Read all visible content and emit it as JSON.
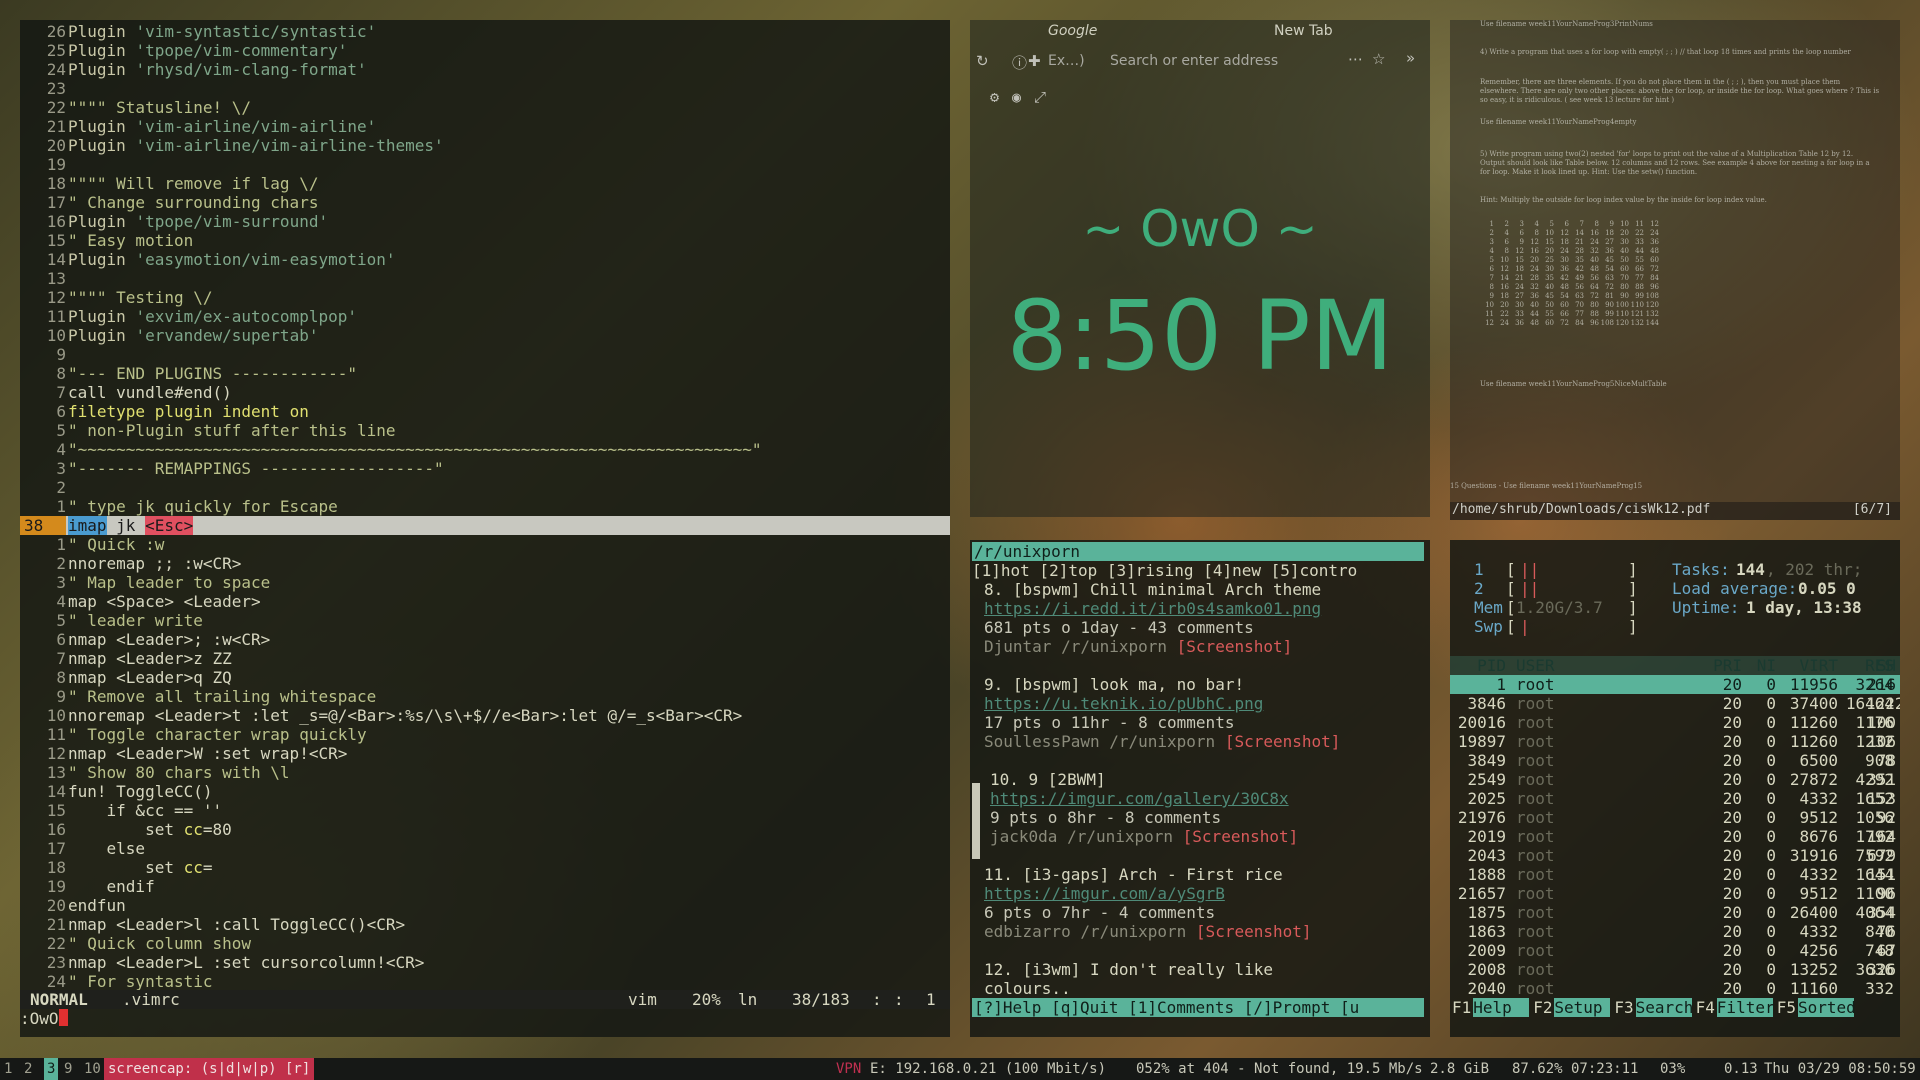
{
  "vim": {
    "lines": [
      {
        "num": "26",
        "segs": [
          [
            "Plugin ",
            "c-plug"
          ],
          [
            "'vim-syntastic/syntastic'",
            "c-str"
          ]
        ]
      },
      {
        "num": "25",
        "segs": [
          [
            "Plugin ",
            "c-plug"
          ],
          [
            "'tpope/vim-commentary'",
            "c-str"
          ]
        ]
      },
      {
        "num": "24",
        "segs": [
          [
            "Plugin ",
            "c-plug"
          ],
          [
            "'rhysd/vim-clang-format'",
            "c-str"
          ]
        ]
      },
      {
        "num": "23",
        "segs": []
      },
      {
        "num": "22",
        "segs": [
          [
            "\"\"\"\" Statusline! \\/",
            "c-com"
          ]
        ]
      },
      {
        "num": "21",
        "segs": [
          [
            "Plugin ",
            "c-plug"
          ],
          [
            "'vim-airline/vim-airline'",
            "c-str"
          ]
        ]
      },
      {
        "num": "20",
        "segs": [
          [
            "Plugin ",
            "c-plug"
          ],
          [
            "'vim-airline/vim-airline-themes'",
            "c-str"
          ]
        ]
      },
      {
        "num": "19",
        "segs": []
      },
      {
        "num": "18",
        "segs": [
          [
            "\"\"\"\" Will remove if lag \\/",
            "c-com"
          ]
        ]
      },
      {
        "num": "17",
        "segs": [
          [
            "\" Change surrounding chars",
            "c-com"
          ]
        ]
      },
      {
        "num": "16",
        "segs": [
          [
            "Plugin ",
            "c-plug"
          ],
          [
            "'tpope/vim-surround'",
            "c-str"
          ]
        ]
      },
      {
        "num": "15",
        "segs": [
          [
            "\" Easy motion",
            "c-com"
          ]
        ]
      },
      {
        "num": "14",
        "segs": [
          [
            "Plugin ",
            "c-plug"
          ],
          [
            "'easymotion/vim-easymotion'",
            "c-str"
          ]
        ]
      },
      {
        "num": "13",
        "segs": []
      },
      {
        "num": "12",
        "segs": [
          [
            "\"\"\"\" Testing \\/",
            "c-com"
          ]
        ]
      },
      {
        "num": "11",
        "segs": [
          [
            "Plugin ",
            "c-plug"
          ],
          [
            "'exvim/ex-autocomplpop'",
            "c-str"
          ]
        ]
      },
      {
        "num": "10",
        "segs": [
          [
            "Plugin ",
            "c-plug"
          ],
          [
            "'ervandew/supertab'",
            "c-str"
          ]
        ]
      },
      {
        "num": "9",
        "segs": []
      },
      {
        "num": "8",
        "segs": [
          [
            "\"--- END PLUGINS ------------\"",
            "c-com"
          ]
        ]
      },
      {
        "num": "7",
        "segs": [
          [
            "call vundle#end()",
            ""
          ]
        ]
      },
      {
        "num": "6",
        "segs": [
          [
            "filetype ",
            "c-key"
          ],
          [
            "plugin indent on",
            "c-key"
          ]
        ]
      },
      {
        "num": "5",
        "segs": [
          [
            "\" non-Plugin stuff after this line",
            "c-com"
          ]
        ]
      },
      {
        "num": "4",
        "segs": [
          [
            "\"~~~~~~~~~~~~~~~~~~~~~~~~~~~~~~~~~~~~~~~~~~~~~~~~~~~~~~~~~~~~~~~~~~~~~~\"",
            "c-com"
          ]
        ]
      },
      {
        "num": "3",
        "segs": [
          [
            "\"------- REMAPPINGS ------------------\"",
            "c-com"
          ]
        ]
      },
      {
        "num": "2",
        "segs": []
      },
      {
        "num": "1",
        "segs": [
          [
            "\" type jk quickly for Escape",
            "c-com"
          ]
        ]
      },
      {
        "num": "38",
        "cur": true,
        "segs": [
          [
            "imap",
            "c-hl"
          ],
          [
            " jk ",
            ""
          ],
          [
            "<Esc>",
            "c-esc"
          ]
        ]
      },
      {
        "num": "1",
        "segs": [
          [
            "\" Quick :w",
            "c-com"
          ]
        ]
      },
      {
        "num": "2",
        "segs": [
          [
            "nnoremap ;; :w<CR>",
            ""
          ]
        ]
      },
      {
        "num": "3",
        "segs": [
          [
            "\" Map leader to space",
            "c-com"
          ]
        ]
      },
      {
        "num": "4",
        "segs": [
          [
            "map <Space> <Leader>",
            ""
          ]
        ]
      },
      {
        "num": "5",
        "segs": [
          [
            "\" leader write",
            "c-com"
          ]
        ]
      },
      {
        "num": "6",
        "segs": [
          [
            "nmap <Leader>; :w<CR>",
            ""
          ]
        ]
      },
      {
        "num": "7",
        "segs": [
          [
            "nmap <Leader>z ZZ",
            ""
          ]
        ]
      },
      {
        "num": "8",
        "segs": [
          [
            "nmap <Leader>q ZQ",
            ""
          ]
        ]
      },
      {
        "num": "9",
        "segs": [
          [
            "\" Remove all trailing whitespace",
            "c-com"
          ]
        ]
      },
      {
        "num": "10",
        "segs": [
          [
            "nnoremap <Leader>t :let _s=@/<Bar>:%s/\\s\\+$//e<Bar>:let @/=_s<Bar><CR>",
            ""
          ]
        ]
      },
      {
        "num": "11",
        "segs": [
          [
            "\" Toggle character wrap quickly",
            "c-com"
          ]
        ]
      },
      {
        "num": "12",
        "segs": [
          [
            "nmap <Leader>W :set wrap!<CR>",
            ""
          ]
        ]
      },
      {
        "num": "13",
        "segs": [
          [
            "\" Show 80 chars with \\l",
            "c-com"
          ]
        ]
      },
      {
        "num": "14",
        "segs": [
          [
            "fun! ToggleCC()",
            ""
          ]
        ]
      },
      {
        "num": "15",
        "segs": [
          [
            "    if &cc == ''",
            ""
          ]
        ]
      },
      {
        "num": "16",
        "segs": [
          [
            "        set ",
            ""
          ],
          [
            "cc",
            "c-key"
          ],
          [
            "=80",
            ""
          ]
        ]
      },
      {
        "num": "17",
        "segs": [
          [
            "    else",
            ""
          ]
        ]
      },
      {
        "num": "18",
        "segs": [
          [
            "        set ",
            ""
          ],
          [
            "cc",
            "c-key"
          ],
          [
            "=",
            ""
          ]
        ]
      },
      {
        "num": "19",
        "segs": [
          [
            "    endif",
            ""
          ]
        ]
      },
      {
        "num": "20",
        "segs": [
          [
            "endfun",
            ""
          ]
        ]
      },
      {
        "num": "21",
        "segs": [
          [
            "nmap <Leader>l :call ToggleCC()<CR>",
            ""
          ]
        ]
      },
      {
        "num": "22",
        "segs": [
          [
            "\" Quick column show",
            "c-com"
          ]
        ]
      },
      {
        "num": "23",
        "segs": [
          [
            "nmap <Leader>L :set cursorcolumn!<CR>",
            ""
          ]
        ]
      },
      {
        "num": "24",
        "segs": [
          [
            "\" For syntastic",
            "c-com"
          ]
        ]
      }
    ],
    "status": {
      "mode": "NORMAL",
      "file": ".vimrc",
      "ft": "vim",
      "pct": "20%",
      "ln": "ln",
      "pos": "38/183",
      "sep": ":",
      "col": "1"
    },
    "cmdline": ":OwO"
  },
  "browser": {
    "tab1": "Google",
    "tab2": "New Tab",
    "url_ext": "Ex…)",
    "url_placeholder": "Search or enter address",
    "face": "~ OwO ~",
    "time": "8:50 PM"
  },
  "pdf": {
    "p1": "Use filename week11YourNameProg3PrintNums",
    "p2": "4) Write a program that uses a for loop with empty( ; ; ) // that loop 18 times and prints the loop number",
    "p3": "Remember, there are three elements. If you do not place them in the ( ; ; ), then you must place them elsewhere. There are only two other places: above the for loop, or inside the for loop. What goes where ? This is so easy, it is ridiculous. ( see week 13 lecture for hint )",
    "p4": "Use filename week11YourNameProg4empty",
    "p5": "5) Write program using two(2) nested 'for' loops to print out the value of a Multiplication Table 12 by 12. Output should look like Table below. 12 columns and 12 rows. See example 4 above for nesting a for loop in a for loop. Make it look lined up. Hint: Use the setw() function.",
    "p6": "Hint: Multiply the outside for loop index value by the inside for loop index value.",
    "p7": "Use filename week11YourNameProg5NiceMultTable",
    "p8": "15 Questions - Use filename week11YourNameProg15",
    "path": "/home/shrub/Downloads/cisWk12.pdf",
    "page": "[6/7]"
  },
  "reddit": {
    "sub": "/r/unixporn",
    "tabs": "[1]hot [2]top [3]rising [4]new [5]contro",
    "lines": [
      {
        "t": "title",
        "v": "8. [bspwm] Chill minimal Arch theme"
      },
      {
        "t": "link",
        "v": "https://i.redd.it/irb0s4samko01.png"
      },
      {
        "t": "meta",
        "v": "681 pts o 1day - 43 comments"
      },
      {
        "t": "user",
        "v": "Djuntar /r/unixporn ",
        "shot": "[Screenshot]"
      },
      {
        "t": "blank",
        "v": ""
      },
      {
        "t": "title",
        "v": "9. [bspwm] look ma, no bar!"
      },
      {
        "t": "link",
        "v": "https://u.teknik.io/pUbhC.png"
      },
      {
        "t": "meta",
        "v": "17 pts o 11hr - 8 comments"
      },
      {
        "t": "user",
        "v": "SoullessPawn /r/unixporn ",
        "shot": "[Screenshot]"
      },
      {
        "t": "blank",
        "v": ""
      },
      {
        "t": "title",
        "v": "10. 9 [2BWM]"
      },
      {
        "t": "link",
        "v": "https://imgur.com/gallery/30C8x"
      },
      {
        "t": "meta",
        "v": "9 pts o 8hr - 8 comments"
      },
      {
        "t": "user",
        "v": "jack0da /r/unixporn ",
        "shot": "[Screenshot]"
      },
      {
        "t": "blank",
        "v": ""
      },
      {
        "t": "title",
        "v": "11. [i3-gaps] Arch - First rice"
      },
      {
        "t": "link",
        "v": "https://imgur.com/a/ySgrB"
      },
      {
        "t": "meta",
        "v": "6 pts o 7hr - 4 comments"
      },
      {
        "t": "user",
        "v": "edbizarro /r/unixporn ",
        "shot": "[Screenshot]"
      },
      {
        "t": "blank",
        "v": ""
      },
      {
        "t": "title",
        "v": "12. [i3wm] I don't really like"
      },
      {
        "t": "title",
        "v": "colours.."
      }
    ],
    "footer": "[?]Help [q]Quit [1]Comments [/]Prompt [u"
  },
  "htop": {
    "cpu1": "1",
    "cpu2": "2",
    "mem": "Mem",
    "mem_val": "1.20G/3.7",
    "swp": "Swp",
    "tasks_label": "Tasks: ",
    "tasks": "144",
    "thr": ", 202 thr;",
    "load_label": "Load average: ",
    "load": "0.05 0",
    "uptime_label": "Uptime: ",
    "uptime": "1 day, 13:38",
    "headers": [
      "PID",
      "USER",
      "PRI",
      "NI",
      "VIRT",
      "RES",
      "SH"
    ],
    "procs": [
      [
        "1",
        "root",
        "20",
        "0",
        "11956",
        "3264",
        "216"
      ],
      [
        "3846",
        "root",
        "20",
        "0",
        "37400",
        "16464",
        "1222"
      ],
      [
        "20016",
        "root",
        "20",
        "0",
        "11260",
        "1176",
        "100"
      ],
      [
        "19897",
        "root",
        "20",
        "0",
        "11260",
        "1232",
        "106"
      ],
      [
        "3849",
        "root",
        "20",
        "0",
        "6500",
        "908",
        "78"
      ],
      [
        "2549",
        "root",
        "20",
        "0",
        "27872",
        "4292",
        "351"
      ],
      [
        "2025",
        "root",
        "20",
        "0",
        "4332",
        "1652",
        "153"
      ],
      [
        "21976",
        "root",
        "20",
        "0",
        "9512",
        "1056",
        "92"
      ],
      [
        "2019",
        "root",
        "20",
        "0",
        "8676",
        "1792",
        "164"
      ],
      [
        "2043",
        "root",
        "20",
        "0",
        "31916",
        "7592",
        "679"
      ],
      [
        "1888",
        "root",
        "20",
        "0",
        "4332",
        "1644",
        "151"
      ],
      [
        "21657",
        "root",
        "20",
        "0",
        "9512",
        "1100",
        "96"
      ],
      [
        "1875",
        "root",
        "20",
        "0",
        "26400",
        "4064",
        "354"
      ],
      [
        "1863",
        "root",
        "20",
        "0",
        "4332",
        "840",
        "76"
      ],
      [
        "2009",
        "root",
        "20",
        "0",
        "4256",
        "748",
        "67"
      ],
      [
        "2008",
        "root",
        "20",
        "0",
        "13252",
        "3636",
        "326"
      ],
      [
        "2040",
        "root",
        "20",
        "0",
        "11160",
        "332",
        ""
      ]
    ],
    "footer": [
      [
        "F1",
        "Help"
      ],
      [
        "F2",
        "Setup"
      ],
      [
        "F3",
        "Search"
      ],
      [
        "F4",
        "Filter"
      ],
      [
        "F5",
        "Sorted"
      ]
    ]
  },
  "bar": {
    "ws": [
      "1",
      "2",
      "3",
      "9",
      "10"
    ],
    "active_ws": "3",
    "screencap": "screencap: (s|d|w|p) [r]",
    "vpn": "VPN",
    "eth": "E: 192.168.0.21 (100 Mbit/s)",
    "disk": "052% at 404 - Not found, 19.5 Mb/s",
    "mem": "2.8 GiB",
    "bat": "87.62% 07:23:11",
    "vol": "03%",
    "load": "0.13",
    "date": "Thu 03/29 08:50:59"
  }
}
